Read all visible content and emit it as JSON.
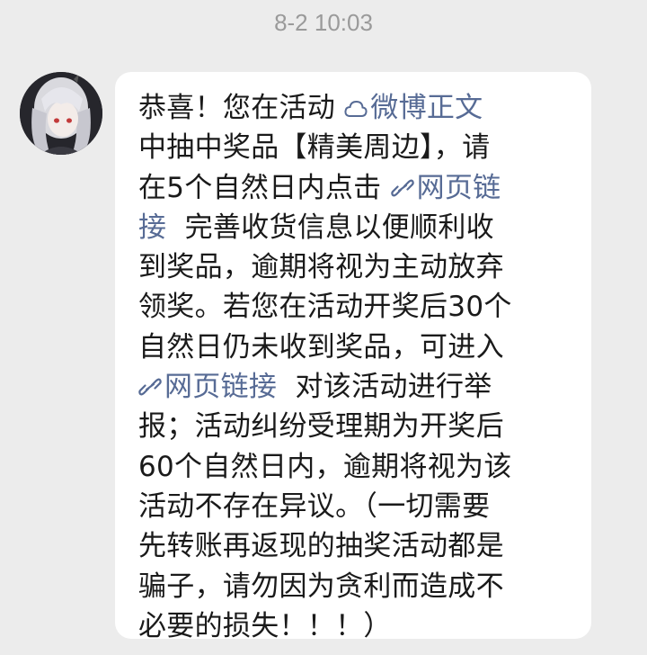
{
  "chat": {
    "timestamp": "8-2 10:03"
  },
  "message": {
    "l1_a": "恭喜！您在活动 ",
    "link_weibo": "微博正文",
    "l2": "中抽中奖品【精美周边】，请",
    "l3_a": "在5个自然日内点击 ",
    "link_web_1a": "网页链",
    "l4_b": "接",
    "l4_c": "  完善收货信息以便顺利收",
    "l5": "到奖品，逾期将视为主动放弃",
    "l6": "领奖。若您在活动开奖后30个",
    "l7": "自然日仍未收到奖品，可进入",
    "link_web_2": "网页链接",
    "l8_b": "  对该活动进行举",
    "l9": "报；活动纠纷受理期为开奖后",
    "l10": "60个自然日内，逾期将视为该",
    "l11": "活动不存在异议。（一切需要",
    "l12": "先转账再返现的抽奖活动都是",
    "l13": "骗子，请勿因为贪利而造成不",
    "l14": "必要的损失！！！）"
  },
  "icons": {
    "weibo": "cloud-icon",
    "web": "link-icon"
  },
  "colors": {
    "background": "#ececec",
    "bubble": "#ffffff",
    "link": "#576b95",
    "text": "#1a1a1a",
    "timestamp": "#9a9a9a"
  }
}
